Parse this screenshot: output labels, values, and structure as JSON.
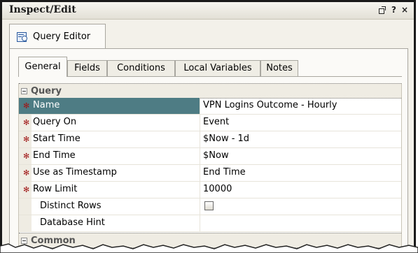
{
  "window": {
    "title": "Inspect/Edit",
    "controls": [
      "?",
      "×"
    ]
  },
  "doc_tab": {
    "label": "Query Editor",
    "icon": "query-editor-icon"
  },
  "tabs": [
    "General",
    "Fields",
    "Conditions",
    "Local Variables",
    "Notes"
  ],
  "active_tab": "General",
  "categories": {
    "query": "Query",
    "common": "Common"
  },
  "properties": [
    {
      "name": "Name",
      "value": "VPN Logins Outcome - Hourly",
      "required": true,
      "selected": true
    },
    {
      "name": "Query On",
      "value": "Event",
      "required": true
    },
    {
      "name": "Start Time",
      "value": "$Now - 1d",
      "required": true
    },
    {
      "name": "End Time",
      "value": "$Now",
      "required": true
    },
    {
      "name": "Use as Timestamp",
      "value": "End Time",
      "required": true
    },
    {
      "name": "Row Limit",
      "value": "10000",
      "required": true
    },
    {
      "name": "Distinct Rows",
      "value": "",
      "checkbox_checked": false,
      "required": false
    },
    {
      "name": "Database Hint",
      "value": "",
      "required": false
    }
  ],
  "required_marker": "✻",
  "colors": {
    "selected_row": "#4e7c84",
    "required_marker": "#a01717"
  }
}
